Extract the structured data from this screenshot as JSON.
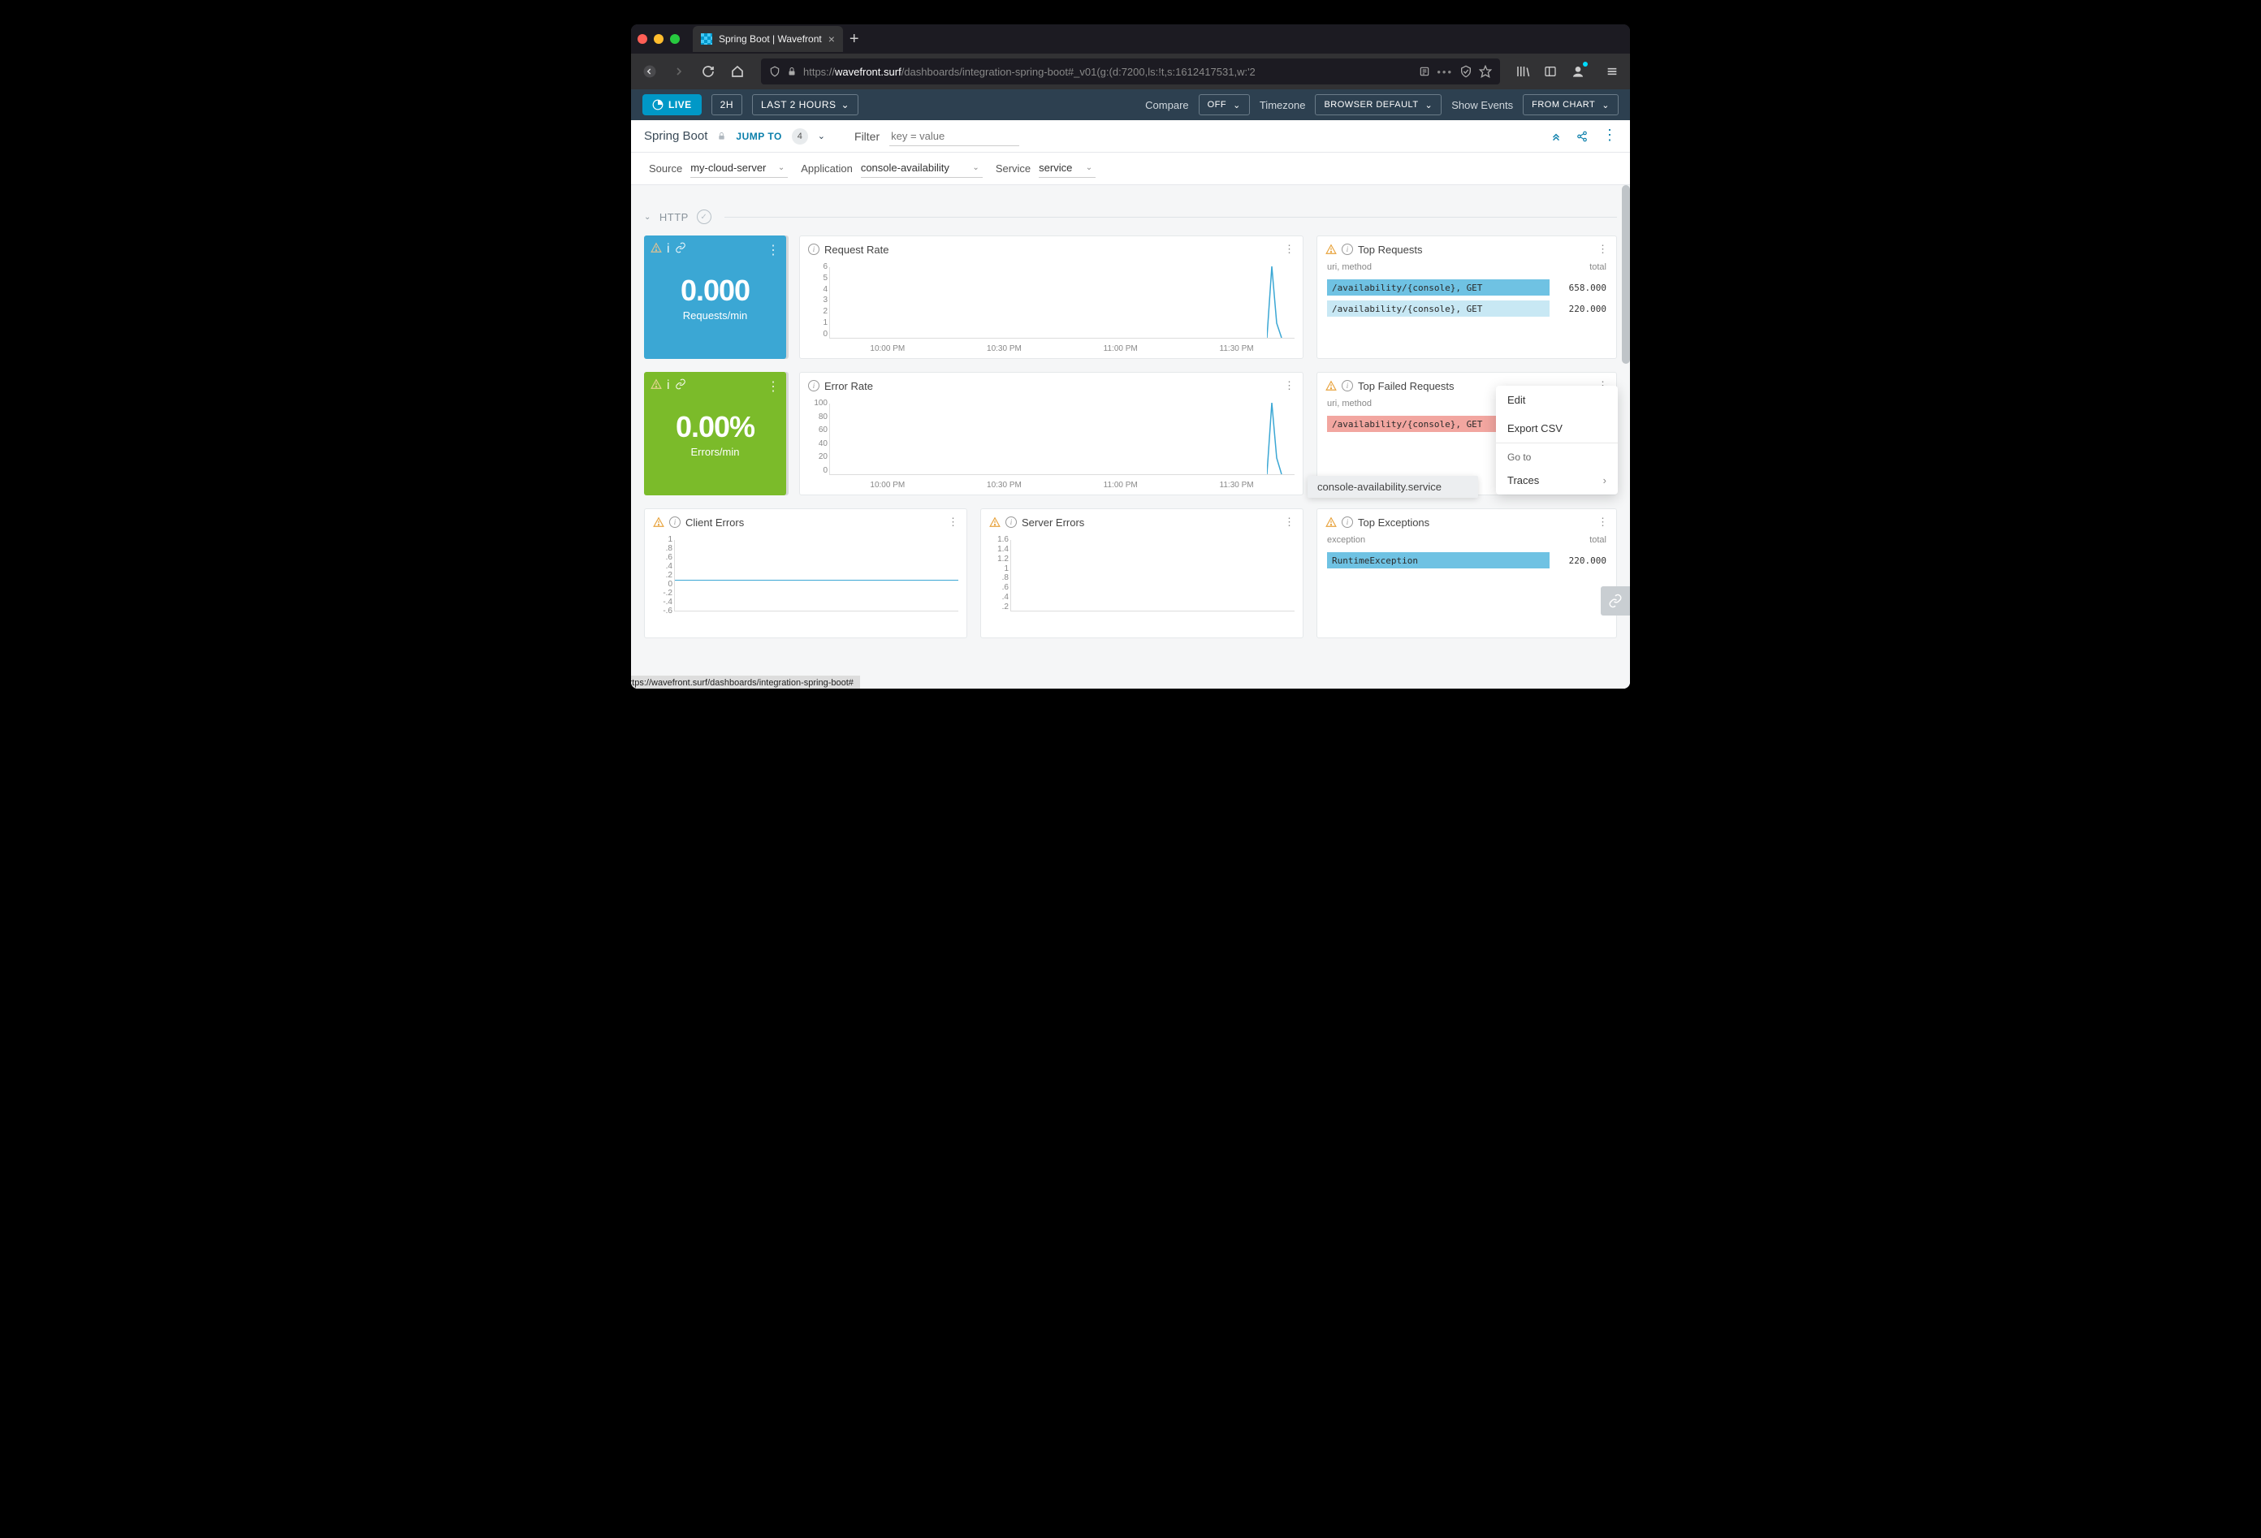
{
  "browser": {
    "tab_title": "Spring Boot | Wavefront",
    "url_prefix": "https://",
    "url_host": "wavefront.surf",
    "url_path": "/dashboards/integration-spring-boot#_v01(g:(d:7200,ls:!t,s:1612417531,w:'2",
    "status_url": "https://wavefront.surf/dashboards/integration-spring-boot#"
  },
  "toolbar": {
    "live": "LIVE",
    "time_short": "2H",
    "time_range": "LAST 2 HOURS",
    "compare_label": "Compare",
    "compare_value": "OFF",
    "timezone_label": "Timezone",
    "timezone_value": "BROWSER DEFAULT",
    "events_label": "Show Events",
    "events_value": "FROM CHART"
  },
  "subhead": {
    "title": "Spring Boot",
    "jump_to": "JUMP TO",
    "jump_count": "4",
    "filter_label": "Filter",
    "filter_placeholder": "key = value"
  },
  "filters": {
    "source_label": "Source",
    "source_value": "my-cloud-server",
    "app_label": "Application",
    "app_value": "console-availability",
    "service_label": "Service",
    "service_value": "service"
  },
  "section_http": "HTTP",
  "stat_cards": {
    "requests": {
      "value": "0.000",
      "unit": "Requests/min"
    },
    "errors": {
      "value": "0.00%",
      "unit": "Errors/min"
    }
  },
  "charts": {
    "request_rate_title": "Request Rate",
    "error_rate_title": "Error Rate",
    "client_errors_title": "Client Errors",
    "server_errors_title": "Server Errors",
    "x_labels": [
      "10:00 PM",
      "10:30 PM",
      "11:00 PM",
      "11:30 PM"
    ]
  },
  "top_requests": {
    "title": "Top Requests",
    "sub_l": "uri, method",
    "sub_r": "total",
    "rows": [
      {
        "label": "/availability/{console}, GET",
        "value": "658.000",
        "color": "blue1"
      },
      {
        "label": "/availability/{console}, GET",
        "value": "220.000",
        "color": "blue2"
      }
    ]
  },
  "top_failed": {
    "title": "Top Failed Requests",
    "sub_l": "uri, method",
    "rows": [
      {
        "label": "/availability/{console}, GET",
        "color": "red1"
      }
    ],
    "tooltip": "console-availability.service"
  },
  "top_exceptions": {
    "title": "Top Exceptions",
    "sub_l": "exception",
    "sub_r": "total",
    "rows": [
      {
        "label": "RuntimeException",
        "value": "220.000",
        "color": "blue1"
      }
    ]
  },
  "ctx_menu": {
    "edit": "Edit",
    "export": "Export CSV",
    "goto": "Go to",
    "traces": "Traces"
  },
  "chart_data": [
    {
      "type": "line",
      "title": "Request Rate",
      "x": [
        "10:00 PM",
        "10:30 PM",
        "11:00 PM",
        "11:30 PM",
        "~11:55 PM"
      ],
      "values": [
        0,
        0,
        0,
        0,
        6
      ],
      "ylim": [
        0,
        6
      ],
      "note": "flat zero with spike to ~6 near end"
    },
    {
      "type": "line",
      "title": "Error Rate",
      "x": [
        "10:00 PM",
        "10:30 PM",
        "11:00 PM",
        "11:30 PM",
        "~11:55 PM"
      ],
      "values": [
        0,
        0,
        0,
        0,
        100
      ],
      "ylim": [
        0,
        100
      ],
      "note": "flat zero with spike to ~100 near end"
    },
    {
      "type": "line",
      "title": "Client Errors",
      "values": [
        0,
        0,
        0,
        0,
        0
      ],
      "ylim": [
        -0.6,
        1
      ],
      "yticks": [
        1,
        0.8,
        0.6,
        0.4,
        0.2,
        0,
        -0.2,
        -0.4,
        -0.6
      ]
    },
    {
      "type": "line",
      "title": "Server Errors",
      "values": [
        0,
        0,
        0,
        0,
        0
      ],
      "ylim": [
        0.2,
        1.6
      ],
      "yticks": [
        1.6,
        1.4,
        1.2,
        1,
        0.8,
        0.6,
        0.4,
        0.2
      ]
    },
    {
      "type": "bar",
      "title": "Top Requests",
      "categories": [
        "/availability/{console}, GET",
        "/availability/{console}, GET"
      ],
      "values": [
        658.0,
        220.0
      ]
    },
    {
      "type": "bar",
      "title": "Top Failed Requests",
      "categories": [
        "/availability/{console}, GET"
      ],
      "values": [
        null
      ]
    },
    {
      "type": "bar",
      "title": "Top Exceptions",
      "categories": [
        "RuntimeException"
      ],
      "values": [
        220.0
      ]
    }
  ]
}
